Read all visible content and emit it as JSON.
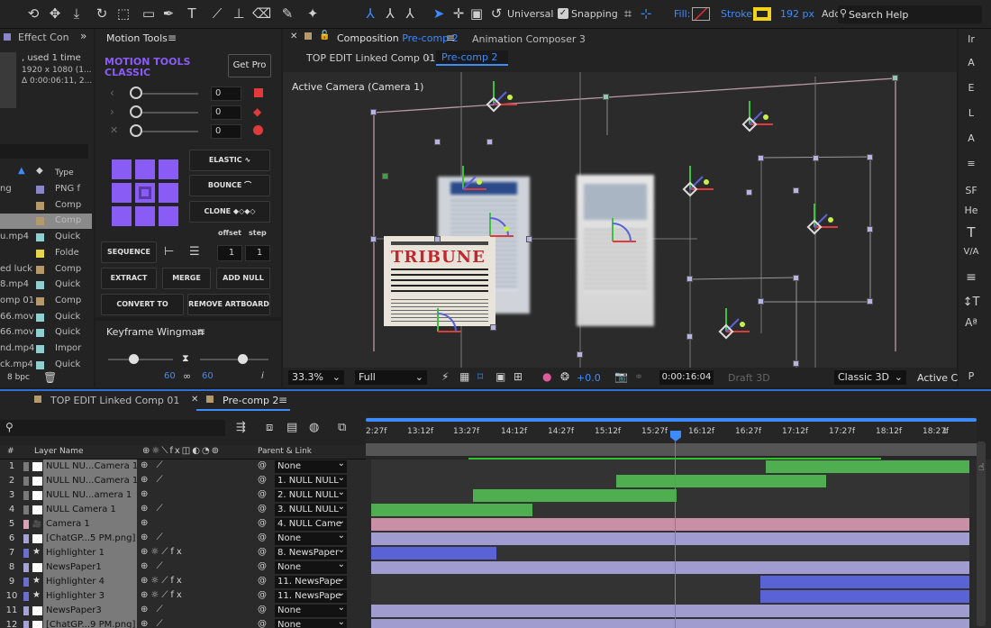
{
  "toolbar": {
    "workspace": "Universal",
    "snapping": "Snapping",
    "fill_label": "Fill:",
    "stroke_label": "Stroke:",
    "stroke_value": "192 px",
    "add_label": "Add:",
    "search_placeholder": "Search Help"
  },
  "project_panel": {
    "tab": "Effect Con",
    "info_line1": ", used 1 time",
    "info_line2": "1920 x 1080 (1...",
    "info_line3": "Δ 0:00:06:11, 2...",
    "type_header": "Type",
    "bpc": "8 bpc",
    "items": [
      {
        "name": "ng",
        "type": "PNG f",
        "color": "#8b86c9"
      },
      {
        "name": "",
        "type": "Comp",
        "color": "#b49a6a"
      },
      {
        "name": "",
        "type": "Comp",
        "color": "#b49a6a"
      },
      {
        "name": "u.mp4",
        "type": "Quick",
        "color": "#8fcfcf"
      },
      {
        "name": "",
        "type": "Folde",
        "color": "#e5d54a"
      },
      {
        "name": "ed luck",
        "type": "Comp",
        "color": "#b49a6a"
      },
      {
        "name": "8.mp4",
        "type": "Quick",
        "color": "#8fcfcf"
      },
      {
        "name": "omp 01",
        "type": "Comp",
        "color": "#b49a6a"
      },
      {
        "name": "66.mov",
        "type": "Quick",
        "color": "#8fcfcf"
      },
      {
        "name": "66.mov",
        "type": "Quick",
        "color": "#8fcfcf"
      },
      {
        "name": "nd.mp4",
        "type": "Impor",
        "color": "#8fcfcf"
      },
      {
        "name": "ck.mp4",
        "type": "Quick",
        "color": "#8fcfcf"
      }
    ]
  },
  "motion_tools": {
    "tab": "Motion Tools",
    "title_line1": "MOTION TOOLS",
    "title_line2": "CLASSIC",
    "get_pro": "Get Pro",
    "slider_values": [
      "0",
      "0",
      "0"
    ],
    "elastic": "ELASTIC",
    "bounce": "BOUNCE",
    "clone": "CLONE",
    "sequence": "SEQUENCE",
    "offset_label": "offset",
    "step_label": "step",
    "offset_value": "1",
    "step_value": "1",
    "extract": "EXTRACT",
    "merge": "MERGE",
    "add_null": "ADD NULL",
    "convert_to_shape": "CONVERT TO SHAPE",
    "remove_artboard": "REMOVE ARTBOARD",
    "accent": "#8a5cf6"
  },
  "keyframe_wingman": {
    "tab": "Keyframe Wingman",
    "left_value": "60",
    "right_value": "60"
  },
  "composition": {
    "tab_label": "Composition",
    "tab_comp": "Pre-comp 2",
    "other_tab": "Animation Composer 3",
    "breadcrumb_parent": "TOP EDIT Linked Comp 01",
    "breadcrumb_current": "Pre-comp 2",
    "camera_label": "Active Camera (Camera 1)",
    "newspaper_headline": "TRIBUNE",
    "zoom": "33.3%",
    "resolution": "Full",
    "exposure": "+0.0",
    "timecode": "0:00:16:04",
    "draft": "Draft 3D",
    "renderer": "Classic 3D",
    "view": "Active C"
  },
  "right_strip": [
    "Ir",
    "A",
    "E",
    "L",
    "A",
    "SF",
    "He"
  ],
  "timeline": {
    "tab1": "TOP EDIT Linked Comp 01",
    "tab2": "Pre-comp 2",
    "search_placeholder": "",
    "col_num": "#",
    "col_layer": "Layer Name",
    "col_parent": "Parent & Link",
    "ticks": [
      "2:27f",
      "13:12f",
      "13:27f",
      "14:12f",
      "14:27f",
      "15:12f",
      "15:27f",
      "16:12f",
      "16:27f",
      "17:12f",
      "17:27f",
      "18:12f",
      "18:27f",
      "1"
    ],
    "layers": [
      {
        "num": "1",
        "name": "NULL NU...Camera 1",
        "parent": "None",
        "label": "#7a7a7a",
        "bar": "#4fae4f",
        "start": 0.66,
        "end": 1.0
      },
      {
        "num": "2",
        "name": "NULL NU...Camera 1",
        "parent": "1. NULL NULL",
        "label": "#7a7a7a",
        "bar": "#4fae4f",
        "start": 0.41,
        "end": 0.76
      },
      {
        "num": "3",
        "name": "NULL NU...amera 1",
        "parent": "2. NULL NULL",
        "label": "#7a7a7a",
        "bar": "#4fae4f",
        "start": 0.17,
        "end": 0.51
      },
      {
        "num": "4",
        "name": "NULL Camera 1",
        "parent": "3. NULL NULL",
        "label": "#7a7a7a",
        "bar": "#4fae4f",
        "start": 0.0,
        "end": 0.27
      },
      {
        "num": "5",
        "name": "Camera 1",
        "parent": "4. NULL Came",
        "label": "#d9a3b4",
        "bar": "#c98fa5",
        "start": 0.0,
        "end": 1.0
      },
      {
        "num": "6",
        "name": "[ChatGP...5 PM.png]",
        "parent": "None",
        "label": "#a6a2d6",
        "bar": "#a09cd0",
        "start": 0.0,
        "end": 1.0
      },
      {
        "num": "7",
        "name": "Highlighter 1",
        "parent": "8. NewsPaper",
        "label": "#6a6fcf",
        "bar": "#5a63d6",
        "start": 0.0,
        "end": 0.21
      },
      {
        "num": "8",
        "name": "NewsPaper1",
        "parent": "None",
        "label": "#a6a2d6",
        "bar": "#a09cd0",
        "start": 0.0,
        "end": 1.0
      },
      {
        "num": "9",
        "name": "Highlighter 4",
        "parent": "11. NewsPape",
        "label": "#6a6fcf",
        "bar": "#5a63d6",
        "start": 0.65,
        "end": 1.0
      },
      {
        "num": "10",
        "name": "Highlighter 3",
        "parent": "11. NewsPape",
        "label": "#6a6fcf",
        "bar": "#5a63d6",
        "start": 0.65,
        "end": 1.0
      },
      {
        "num": "11",
        "name": "NewsPaper3",
        "parent": "None",
        "label": "#a6a2d6",
        "bar": "#a09cd0",
        "start": 0.0,
        "end": 1.0
      },
      {
        "num": "12",
        "name": "[ChatGP...9 PM.png]",
        "parent": "None",
        "label": "#a6a2d6",
        "bar": "#a09cd0",
        "start": 0.0,
        "end": 1.0
      }
    ]
  }
}
